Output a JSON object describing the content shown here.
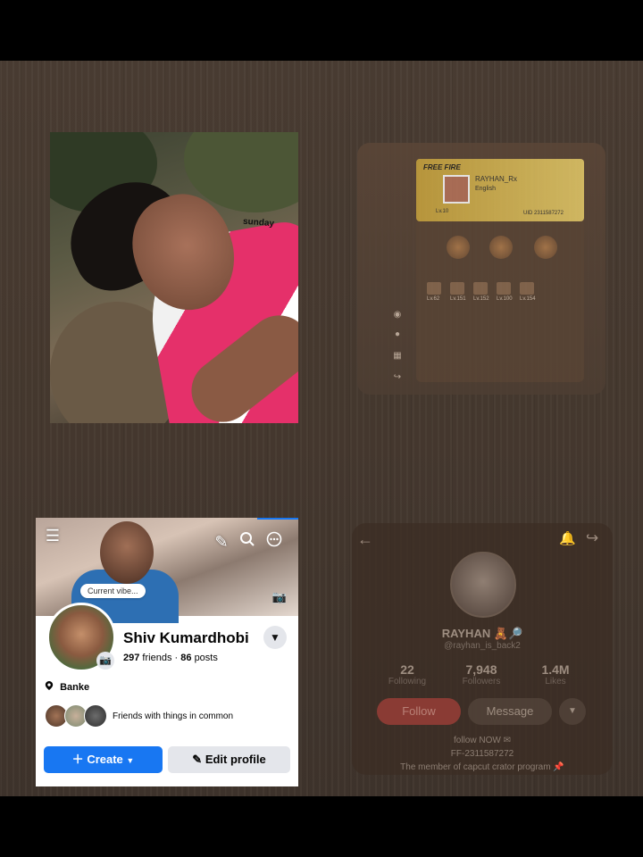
{
  "photo": {
    "sticker_text": "sunday"
  },
  "game_card": {
    "logo": "FREE FIRE",
    "player_name": "RAYHAN_Rx",
    "player_tag": "English",
    "level": "Lv.10",
    "uid": "UID 2311587272",
    "slot_labels": [
      "Lv.62",
      "Lv.151",
      "Lv.152",
      "Lv.100",
      "Lv.154"
    ]
  },
  "facebook": {
    "cover_bubble": "Current vibe...",
    "name": "Shiv Kumardhobi",
    "friends_count": "297",
    "friends_label": "friends",
    "posts_count": "86",
    "posts_label": "posts",
    "separator": "·",
    "location": "Banke",
    "common_text": "Friends with things in common",
    "create_label": "Create",
    "edit_profile_label": "Edit profile"
  },
  "profile_card": {
    "name": "RAYHAN 🧸🔎",
    "handle": "@rayhan_is_back2",
    "stats": [
      {
        "value": "22",
        "label": "Following"
      },
      {
        "value": "7,948",
        "label": "Followers"
      },
      {
        "value": "1.4M",
        "label": "Likes"
      }
    ],
    "follow_label": "Follow",
    "message_label": "Message",
    "bio_lines": [
      "follow NOW ✉",
      "FF-2311587272",
      "The member of capcut crator program 📌"
    ]
  },
  "icons": {
    "menu": "hamburger-icon",
    "edit": "pencil-icon",
    "search": "search-icon",
    "more": "more-icon",
    "camera": "camera-icon",
    "location": "pin-icon",
    "back": "back-arrow-icon",
    "bell": "bell-icon",
    "share": "share-icon"
  },
  "colors": {
    "fb_blue": "#1877f2",
    "follow_red": "#8a3b34",
    "background": "#46392f"
  }
}
